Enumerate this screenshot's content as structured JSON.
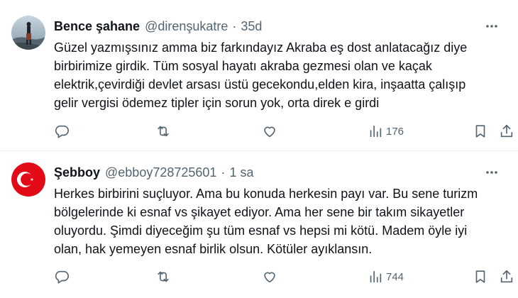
{
  "colors": {
    "text": "#0f1419",
    "secondary": "#536471",
    "divider": "#eff3f4",
    "flag_red": "#e30a17"
  },
  "tweets": [
    {
      "author_name": "Bence şahane",
      "handle": "@direnşukatre",
      "separator": "·",
      "time": "35d",
      "avatar": "profile-photo",
      "lines": [
        "Güzel yazmışsınız amma biz farkındayız Akraba eş dost anlatacağız diye",
        "birbirimize girdik. Tüm sosyal hayatı akraba gezmesi olan ve kaçak",
        "elektrik,çevirdiği devlet arsası üstü gecekondu,elden kira, inşaatta çalışıp",
        "gelir vergisi ödemez tipler için sorun yok, orta direk e girdi"
      ],
      "views": "176",
      "icons": [
        "reply-icon",
        "retweet-icon",
        "like-icon",
        "views-icon",
        "bookmark-icon",
        "share-icon",
        "more-icon"
      ]
    },
    {
      "author_name": "Şebboy",
      "handle": "@ebboy728725601",
      "separator": "·",
      "time": "1 sa",
      "avatar": "turkish-flag",
      "lines": [
        "Herkes birbirini suçluyor. Ama bu konuda herkesin payı var. Bu sene turizm",
        "bölgelerinde ki esnaf vs şikayet ediyor. Ama her sene bir takım sikayetler",
        "oluyordu. Şimdi diyeceğim şu tüm esnaf vs hepsi mi kötü. Madem öyle iyi",
        "olan, hak yemeyen esnaf birlik olsun. Kötüler ayıklansın."
      ],
      "views": "744",
      "icons": [
        "reply-icon",
        "retweet-icon",
        "like-icon",
        "views-icon",
        "bookmark-icon",
        "share-icon",
        "more-icon"
      ]
    }
  ]
}
